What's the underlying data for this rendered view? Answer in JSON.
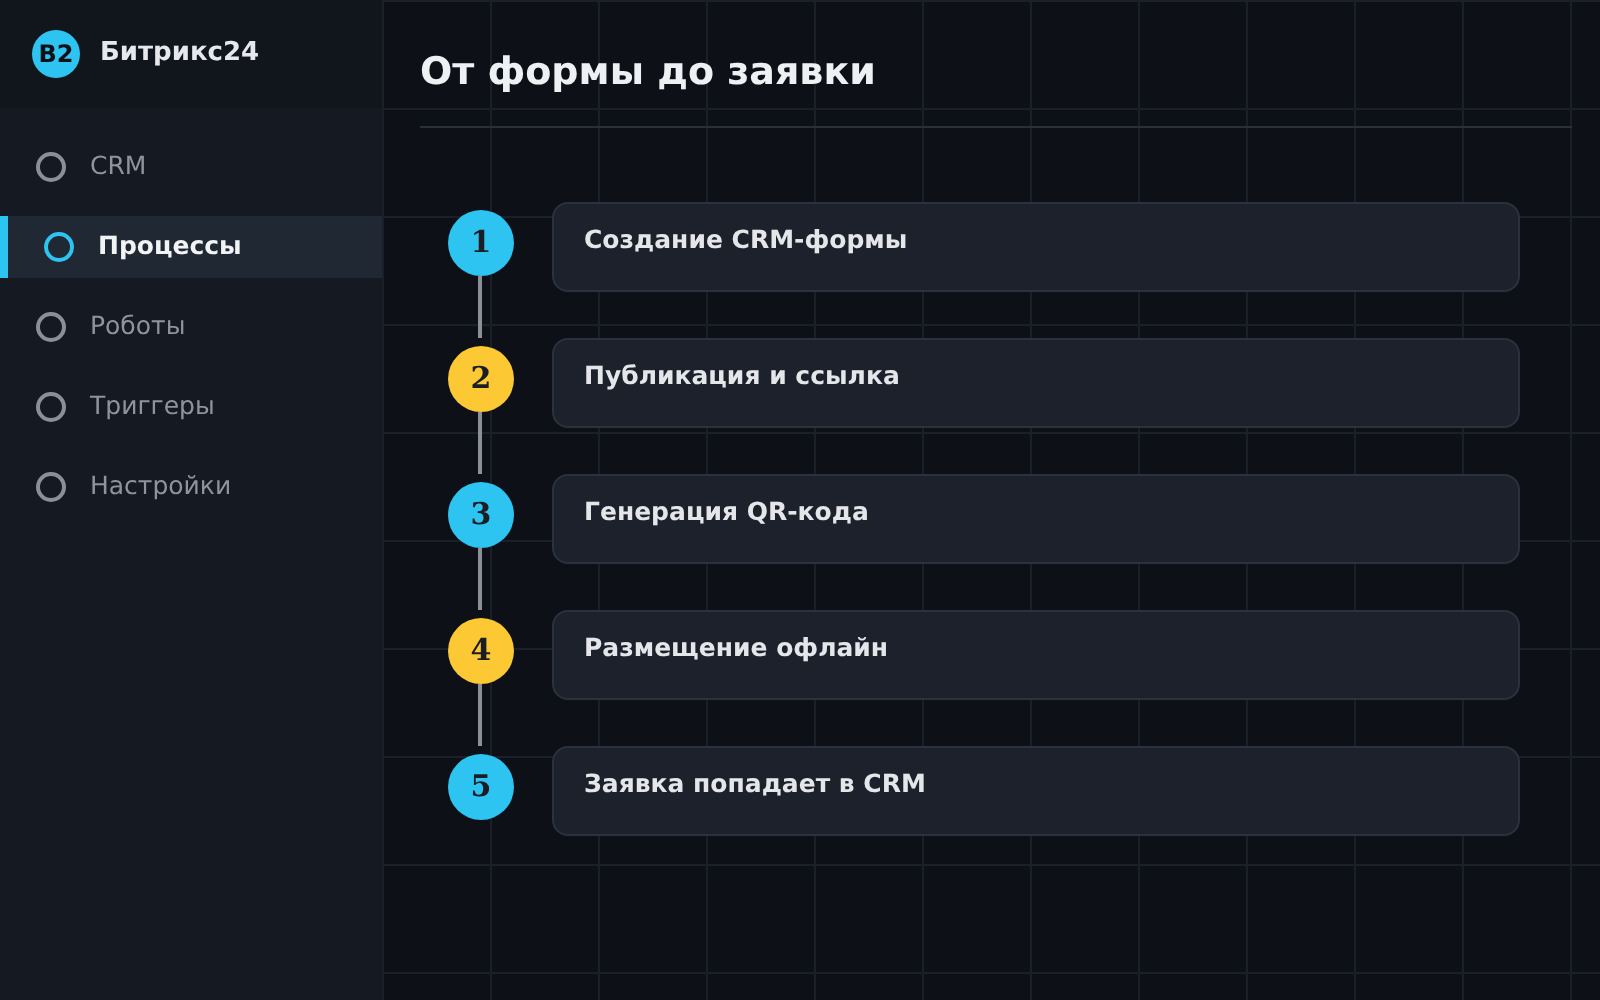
{
  "sidebar": {
    "logo": {
      "mark": "B2",
      "name": "Битрикс24"
    },
    "items": [
      {
        "label": "CRM",
        "selected": false
      },
      {
        "label": "Процессы",
        "selected": true
      },
      {
        "label": "Роботы",
        "selected": false
      },
      {
        "label": "Триггеры",
        "selected": false
      },
      {
        "label": "Настройки",
        "selected": false
      }
    ]
  },
  "main": {
    "title": "От формы до заявки",
    "steps": [
      {
        "number": "1",
        "title": "Создание CRM-формы",
        "color": "#2ec4f1"
      },
      {
        "number": "2",
        "title": "Публикация и ссылка",
        "color": "#fcc934"
      },
      {
        "number": "3",
        "title": "Генерация QR-кода",
        "color": "#2ec4f1"
      },
      {
        "number": "4",
        "title": "Размещение офлайн",
        "color": "#fcc934"
      },
      {
        "number": "5",
        "title": "Заявка попадает в CRM",
        "color": "#2ec4f1"
      }
    ]
  }
}
